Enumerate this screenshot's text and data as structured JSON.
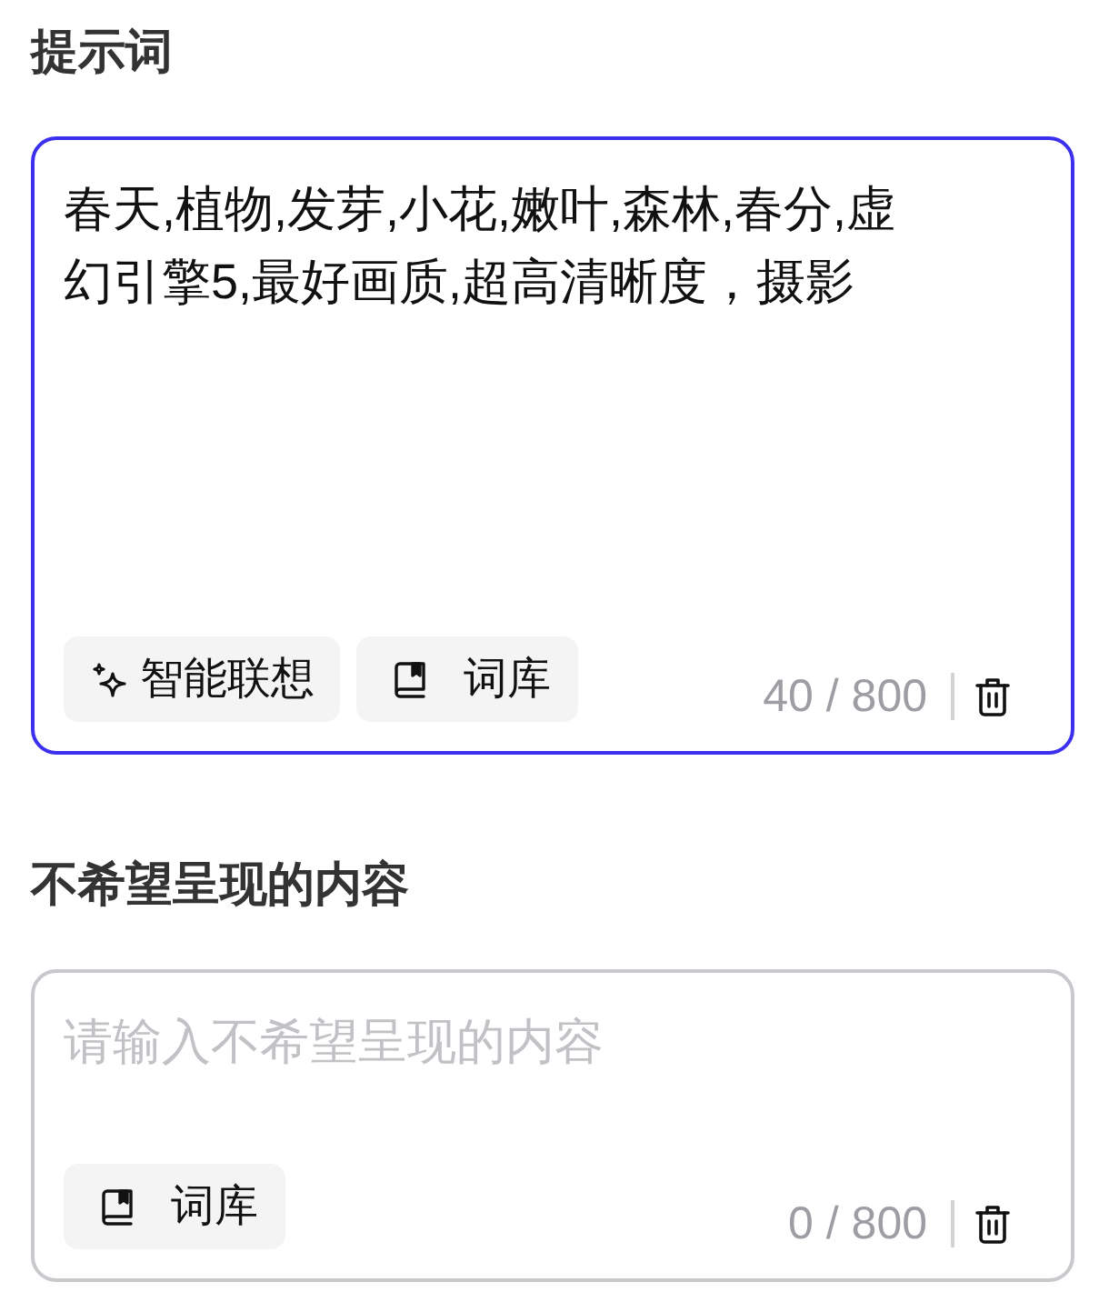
{
  "sections": [
    {
      "title": "提示词",
      "field": {
        "value": "春天,植物,发芽,小花,嫩叶,森林,春分,虚幻引擎5,最好画质,超高清晰度，摄影",
        "focused": true
      },
      "buttons": [
        {
          "kind": "sparkle",
          "label": "智能联想"
        },
        {
          "kind": "book",
          "label": "词库"
        }
      ],
      "counter": "40 / 800"
    },
    {
      "title": "不希望呈现的内容",
      "field": {
        "placeholder": "请输入不希望呈现的内容",
        "focused": false
      },
      "buttons": [
        {
          "kind": "book",
          "label": "词库"
        }
      ],
      "counter": "0 / 800"
    }
  ]
}
